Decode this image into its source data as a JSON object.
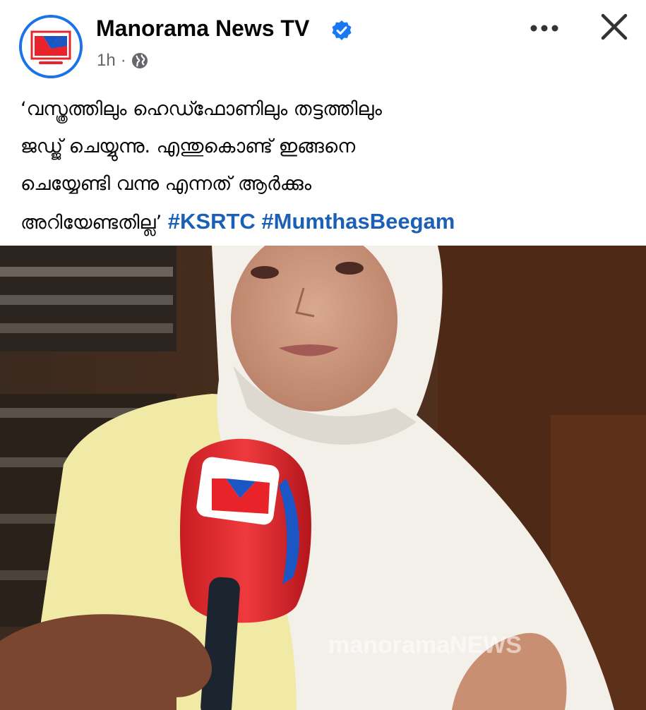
{
  "post": {
    "page_name": "Manorama News TV",
    "time": "1h",
    "separator": "·",
    "caption_lines": [
      "‘വസ്ത്രത്തിലും ഹെഡ്ഫോണിലും തട്ടത്തിലും",
      "ജഡ്ജ് ചെയ്യുന്നു. എന്തുകൊണ്ട് ഇങ്ങനെ",
      "ചെയ്യേണ്ടി വന്നു എന്നത് ആർക്കും",
      "അറിയേണ്ടതില്ല’"
    ],
    "hashtags": [
      "#KSRTC",
      "#MumthasBeegam"
    ],
    "watermark": "manoramaNEWS"
  },
  "icons": {
    "avatar": "manorama-logo",
    "verified": "verified-badge-icon",
    "privacy": "globe-icon",
    "more": "more-options-icon",
    "close": "close-icon"
  },
  "colors": {
    "brand_blue": "#1a73e8",
    "hashtag": "#1c5fb6",
    "meta_gray": "#65676b",
    "mic_red": "#e8242a"
  }
}
